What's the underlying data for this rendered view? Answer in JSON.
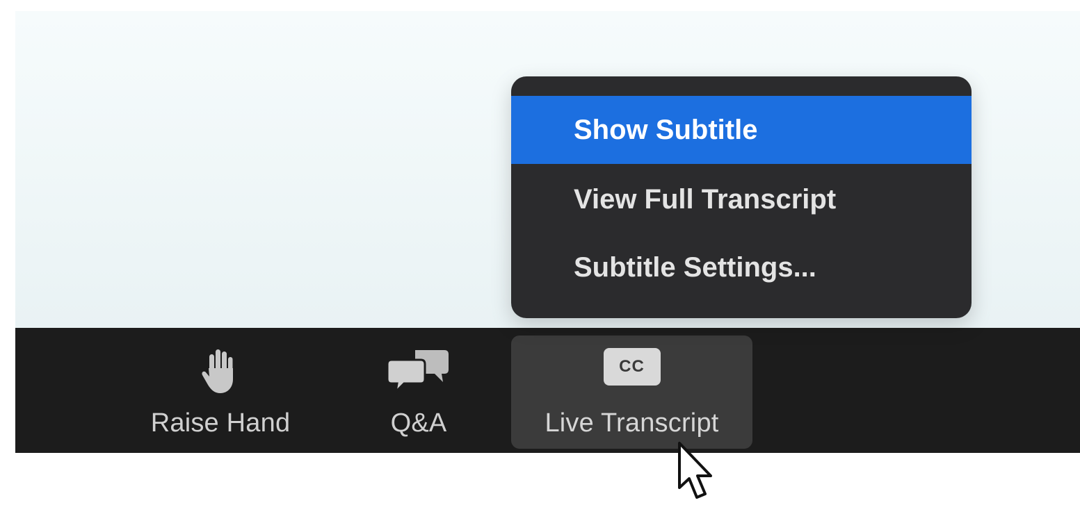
{
  "toolbar": {
    "raise_hand": {
      "label": "Raise Hand",
      "icon": "hand-icon"
    },
    "qa": {
      "label": "Q&A",
      "icon": "chat-bubbles-icon"
    },
    "live_transcript": {
      "label": "Live Transcript",
      "icon": "cc-icon",
      "badge": "CC"
    }
  },
  "menu": {
    "items": [
      {
        "label": "Show Subtitle",
        "highlighted": true
      },
      {
        "label": "View Full Transcript",
        "highlighted": false
      },
      {
        "label": "Subtitle Settings...",
        "highlighted": false
      }
    ]
  },
  "colors": {
    "highlight": "#1c6fe0",
    "menu_bg": "#2b2b2d",
    "toolbar_bg": "#1c1c1c",
    "active_button_bg": "#3b3b3b"
  }
}
